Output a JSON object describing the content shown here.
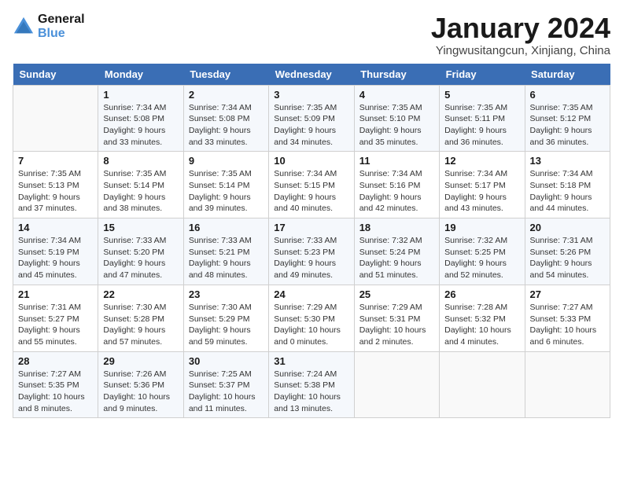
{
  "header": {
    "logo_line1": "General",
    "logo_line2": "Blue",
    "title": "January 2024",
    "subtitle": "Yingwusitangcun, Xinjiang, China"
  },
  "days_of_week": [
    "Sunday",
    "Monday",
    "Tuesday",
    "Wednesday",
    "Thursday",
    "Friday",
    "Saturday"
  ],
  "weeks": [
    [
      {
        "day": "",
        "info": ""
      },
      {
        "day": "1",
        "info": "Sunrise: 7:34 AM\nSunset: 5:08 PM\nDaylight: 9 hours\nand 33 minutes."
      },
      {
        "day": "2",
        "info": "Sunrise: 7:34 AM\nSunset: 5:08 PM\nDaylight: 9 hours\nand 33 minutes."
      },
      {
        "day": "3",
        "info": "Sunrise: 7:35 AM\nSunset: 5:09 PM\nDaylight: 9 hours\nand 34 minutes."
      },
      {
        "day": "4",
        "info": "Sunrise: 7:35 AM\nSunset: 5:10 PM\nDaylight: 9 hours\nand 35 minutes."
      },
      {
        "day": "5",
        "info": "Sunrise: 7:35 AM\nSunset: 5:11 PM\nDaylight: 9 hours\nand 36 minutes."
      },
      {
        "day": "6",
        "info": "Sunrise: 7:35 AM\nSunset: 5:12 PM\nDaylight: 9 hours\nand 36 minutes."
      }
    ],
    [
      {
        "day": "7",
        "info": "Sunrise: 7:35 AM\nSunset: 5:13 PM\nDaylight: 9 hours\nand 37 minutes."
      },
      {
        "day": "8",
        "info": "Sunrise: 7:35 AM\nSunset: 5:14 PM\nDaylight: 9 hours\nand 38 minutes."
      },
      {
        "day": "9",
        "info": "Sunrise: 7:35 AM\nSunset: 5:14 PM\nDaylight: 9 hours\nand 39 minutes."
      },
      {
        "day": "10",
        "info": "Sunrise: 7:34 AM\nSunset: 5:15 PM\nDaylight: 9 hours\nand 40 minutes."
      },
      {
        "day": "11",
        "info": "Sunrise: 7:34 AM\nSunset: 5:16 PM\nDaylight: 9 hours\nand 42 minutes."
      },
      {
        "day": "12",
        "info": "Sunrise: 7:34 AM\nSunset: 5:17 PM\nDaylight: 9 hours\nand 43 minutes."
      },
      {
        "day": "13",
        "info": "Sunrise: 7:34 AM\nSunset: 5:18 PM\nDaylight: 9 hours\nand 44 minutes."
      }
    ],
    [
      {
        "day": "14",
        "info": "Sunrise: 7:34 AM\nSunset: 5:19 PM\nDaylight: 9 hours\nand 45 minutes."
      },
      {
        "day": "15",
        "info": "Sunrise: 7:33 AM\nSunset: 5:20 PM\nDaylight: 9 hours\nand 47 minutes."
      },
      {
        "day": "16",
        "info": "Sunrise: 7:33 AM\nSunset: 5:21 PM\nDaylight: 9 hours\nand 48 minutes."
      },
      {
        "day": "17",
        "info": "Sunrise: 7:33 AM\nSunset: 5:23 PM\nDaylight: 9 hours\nand 49 minutes."
      },
      {
        "day": "18",
        "info": "Sunrise: 7:32 AM\nSunset: 5:24 PM\nDaylight: 9 hours\nand 51 minutes."
      },
      {
        "day": "19",
        "info": "Sunrise: 7:32 AM\nSunset: 5:25 PM\nDaylight: 9 hours\nand 52 minutes."
      },
      {
        "day": "20",
        "info": "Sunrise: 7:31 AM\nSunset: 5:26 PM\nDaylight: 9 hours\nand 54 minutes."
      }
    ],
    [
      {
        "day": "21",
        "info": "Sunrise: 7:31 AM\nSunset: 5:27 PM\nDaylight: 9 hours\nand 55 minutes."
      },
      {
        "day": "22",
        "info": "Sunrise: 7:30 AM\nSunset: 5:28 PM\nDaylight: 9 hours\nand 57 minutes."
      },
      {
        "day": "23",
        "info": "Sunrise: 7:30 AM\nSunset: 5:29 PM\nDaylight: 9 hours\nand 59 minutes."
      },
      {
        "day": "24",
        "info": "Sunrise: 7:29 AM\nSunset: 5:30 PM\nDaylight: 10 hours\nand 0 minutes."
      },
      {
        "day": "25",
        "info": "Sunrise: 7:29 AM\nSunset: 5:31 PM\nDaylight: 10 hours\nand 2 minutes."
      },
      {
        "day": "26",
        "info": "Sunrise: 7:28 AM\nSunset: 5:32 PM\nDaylight: 10 hours\nand 4 minutes."
      },
      {
        "day": "27",
        "info": "Sunrise: 7:27 AM\nSunset: 5:33 PM\nDaylight: 10 hours\nand 6 minutes."
      }
    ],
    [
      {
        "day": "28",
        "info": "Sunrise: 7:27 AM\nSunset: 5:35 PM\nDaylight: 10 hours\nand 8 minutes."
      },
      {
        "day": "29",
        "info": "Sunrise: 7:26 AM\nSunset: 5:36 PM\nDaylight: 10 hours\nand 9 minutes."
      },
      {
        "day": "30",
        "info": "Sunrise: 7:25 AM\nSunset: 5:37 PM\nDaylight: 10 hours\nand 11 minutes."
      },
      {
        "day": "31",
        "info": "Sunrise: 7:24 AM\nSunset: 5:38 PM\nDaylight: 10 hours\nand 13 minutes."
      },
      {
        "day": "",
        "info": ""
      },
      {
        "day": "",
        "info": ""
      },
      {
        "day": "",
        "info": ""
      }
    ]
  ]
}
